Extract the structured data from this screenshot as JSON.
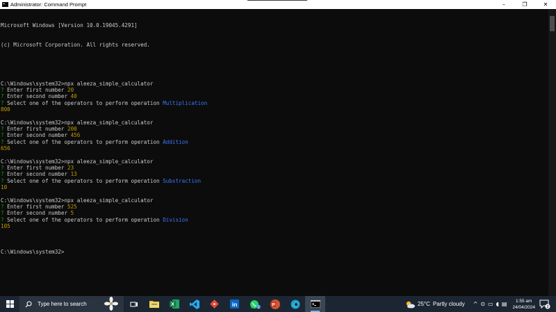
{
  "window": {
    "title": "Administrator: Command Prompt",
    "controls": {
      "minimize": "–",
      "maximize": "❐",
      "close": "✕"
    }
  },
  "console": {
    "header": [
      "Microsoft Windows [Version 10.0.19045.4291]",
      "(c) Microsoft Corporation. All rights reserved."
    ],
    "prompt": "C:\\Windows\\system32>",
    "command": "npx aleeza_simple_calculator",
    "q_mark": "?",
    "q1": "Enter first number",
    "q2": "Enter second number",
    "q3": "Select one of the operators to perform operation",
    "runs": [
      {
        "first": "20",
        "second": "40",
        "op": "Multiplication",
        "result": "800"
      },
      {
        "first": "200",
        "second": "456",
        "op": "Addition",
        "result": "656"
      },
      {
        "first": "23",
        "second": "13",
        "op": "Substraction",
        "result": "10"
      },
      {
        "first": "525",
        "second": "5",
        "op": "Division",
        "result": "105"
      }
    ]
  },
  "taskbar": {
    "search_placeholder": "Type here to search",
    "apps": [
      {
        "name": "windows-start",
        "icon": "windows-logo-icon"
      },
      {
        "name": "task-view",
        "icon": "task-view-icon"
      },
      {
        "name": "file-explorer",
        "icon": "folder-icon"
      },
      {
        "name": "excel",
        "icon": "excel-icon"
      },
      {
        "name": "vscode",
        "icon": "vscode-icon"
      },
      {
        "name": "git",
        "icon": "git-icon"
      },
      {
        "name": "linkedin",
        "icon": "linkedin-icon"
      },
      {
        "name": "whatsapp",
        "icon": "whatsapp-icon",
        "badge": "1"
      },
      {
        "name": "powerpoint",
        "icon": "powerpoint-icon"
      },
      {
        "name": "edge",
        "icon": "edge-icon"
      },
      {
        "name": "command-prompt",
        "icon": "terminal-icon"
      }
    ],
    "weather": {
      "temp": "25°C",
      "condition": "Partly cloudy"
    },
    "time": "1:55 am",
    "date": "24/04/2024",
    "notifications": "2"
  },
  "colors": {
    "console_bg": "#0c0c0c",
    "console_text": "#cccccc",
    "question_mark": "#13a10e",
    "number_input": "#c19c00",
    "operator_choice": "#3b78ff",
    "taskbar_bg": "#1c2633"
  }
}
